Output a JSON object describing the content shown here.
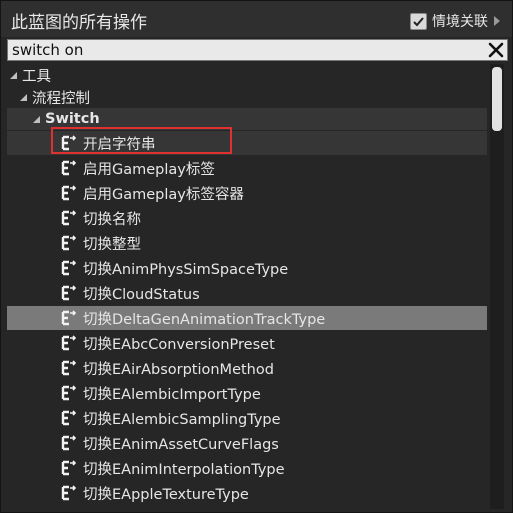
{
  "header": {
    "title": "此蓝图的所有操作",
    "context_label": "情境关联",
    "context_checked": true
  },
  "search": {
    "value": "switch on"
  },
  "tree": {
    "category": "工具",
    "subcategory": "流程控制",
    "group": "Switch",
    "items": [
      "开启字符串",
      "启用Gameplay标签",
      "启用Gameplay标签容器",
      "切换名称",
      "切换整型",
      "切换AnimPhysSimSpaceType",
      "切换CloudStatus",
      "切换DeltaGenAnimationTrackType",
      "切换EAbcConversionPreset",
      "切换EAirAbsorptionMethod",
      "切换EAlembicImportType",
      "切换EAlembicSamplingType",
      "切换EAnimAssetCurveFlags",
      "切换EAnimInterpolationType",
      "切换EAppleTextureType"
    ],
    "selected_index": 7,
    "highlighted_index": 0
  },
  "colors": {
    "highlight": "#e03030",
    "selected_row": "#7a7a7a"
  }
}
